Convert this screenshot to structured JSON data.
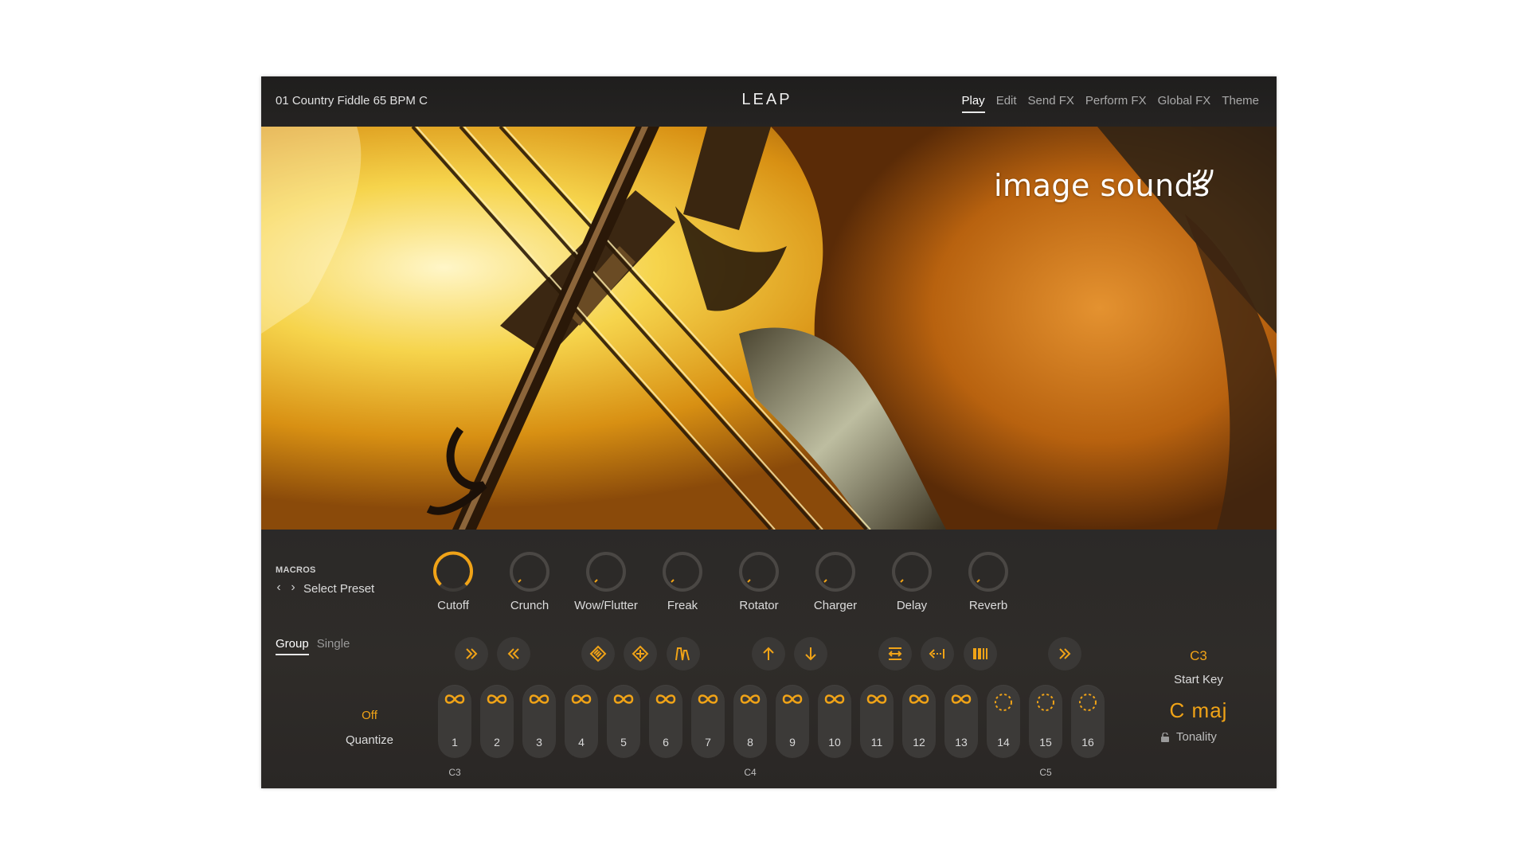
{
  "header": {
    "preset_name": "01 Country Fiddle 65 BPM C",
    "logo_text": "LEAP",
    "tabs": [
      {
        "label": "Play",
        "active": true
      },
      {
        "label": "Edit",
        "active": false
      },
      {
        "label": "Send FX",
        "active": false
      },
      {
        "label": "Perform FX",
        "active": false
      },
      {
        "label": "Global FX",
        "active": false
      },
      {
        "label": "Theme",
        "active": false
      }
    ]
  },
  "hero": {
    "brand": "image sounds",
    "brand_icon": "broadcast-waves-icon"
  },
  "macros": {
    "label": "MACROS",
    "prev_icon": "chevron-left-icon",
    "next_icon": "chevron-right-icon",
    "select_preset": "Select Preset",
    "knobs": [
      {
        "label": "Cutoff",
        "value": 0.95,
        "active": true
      },
      {
        "label": "Crunch",
        "value": 0.0,
        "active": false
      },
      {
        "label": "Wow/Flutter",
        "value": 0.0,
        "active": false
      },
      {
        "label": "Freak",
        "value": 0.0,
        "active": false
      },
      {
        "label": "Rotator",
        "value": 0.0,
        "active": false
      },
      {
        "label": "Charger",
        "value": 0.0,
        "active": false
      },
      {
        "label": "Delay",
        "value": 0.0,
        "active": false
      },
      {
        "label": "Reverb",
        "value": 0.0,
        "active": false
      }
    ]
  },
  "mode": {
    "tabs": [
      {
        "label": "Group",
        "active": true
      },
      {
        "label": "Single",
        "active": false
      }
    ]
  },
  "quantize": {
    "value": "Off",
    "label": "Quantize"
  },
  "toolbar": {
    "buttons": [
      {
        "icon": "double-chevron-right-icon"
      },
      {
        "icon": "double-chevron-left-icon"
      },
      {
        "icon": "dice-diamond-icon"
      },
      {
        "icon": "dice-diamond-alt-icon"
      },
      {
        "icon": "envelope-shape-icon"
      },
      {
        "icon": "arrow-up-icon"
      },
      {
        "icon": "arrow-down-icon"
      },
      {
        "icon": "stretch-icon"
      },
      {
        "icon": "reverse-icon"
      },
      {
        "icon": "bars-icon"
      },
      {
        "icon": "double-chevron-right-icon"
      }
    ]
  },
  "pads": [
    {
      "number": "1",
      "icon": "loop-icon"
    },
    {
      "number": "2",
      "icon": "loop-icon"
    },
    {
      "number": "3",
      "icon": "loop-icon"
    },
    {
      "number": "4",
      "icon": "loop-icon"
    },
    {
      "number": "5",
      "icon": "loop-icon"
    },
    {
      "number": "6",
      "icon": "loop-icon"
    },
    {
      "number": "7",
      "icon": "loop-icon"
    },
    {
      "number": "8",
      "icon": "loop-icon"
    },
    {
      "number": "9",
      "icon": "loop-icon"
    },
    {
      "number": "10",
      "icon": "loop-icon"
    },
    {
      "number": "11",
      "icon": "loop-icon"
    },
    {
      "number": "12",
      "icon": "loop-icon"
    },
    {
      "number": "13",
      "icon": "loop-icon"
    },
    {
      "number": "14",
      "icon": "one-shot-icon"
    },
    {
      "number": "15",
      "icon": "one-shot-icon"
    },
    {
      "number": "16",
      "icon": "one-shot-icon"
    }
  ],
  "key_labels": [
    "C3",
    "C4",
    "C5"
  ],
  "start_key": {
    "value": "C3",
    "label": "Start Key"
  },
  "tonality": {
    "value": "C  maj",
    "label": "Tonality",
    "lock_icon": "lock-icon"
  },
  "colors": {
    "accent": "#f0a317",
    "panel_bg": "#2b2928",
    "header_bg": "#1f1e1d",
    "pad_bg": "#3c3a38"
  }
}
